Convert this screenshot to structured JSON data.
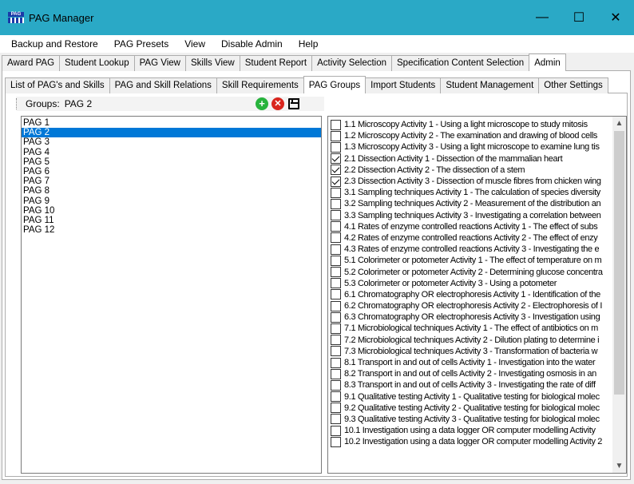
{
  "window": {
    "title": "PAG Manager",
    "icon_text": "PAG",
    "minimize": "—",
    "maximize": "☐",
    "close": "✕"
  },
  "menu": [
    {
      "label": "Backup and Restore"
    },
    {
      "label": "PAG Presets"
    },
    {
      "label": "View"
    },
    {
      "label": "Disable Admin"
    },
    {
      "label": "Help"
    }
  ],
  "main_tabs": [
    {
      "label": "Award PAG",
      "active": false
    },
    {
      "label": "Student Lookup",
      "active": false
    },
    {
      "label": "PAG View",
      "active": false
    },
    {
      "label": "Skills View",
      "active": false
    },
    {
      "label": "Student Report",
      "active": false
    },
    {
      "label": "Activity Selection",
      "active": false
    },
    {
      "label": "Specification Content Selection",
      "active": false
    },
    {
      "label": "Admin",
      "active": true
    }
  ],
  "admin_tabs": [
    {
      "label": "List of PAG's and Skills",
      "active": false
    },
    {
      "label": "PAG and Skill Relations",
      "active": false
    },
    {
      "label": "Skill Requirements",
      "active": false
    },
    {
      "label": "PAG Groups",
      "active": true
    },
    {
      "label": "Import Students",
      "active": false
    },
    {
      "label": "Student Management",
      "active": false
    },
    {
      "label": "Other Settings",
      "active": false
    }
  ],
  "toolbar": {
    "groups_label": "Groups:",
    "groups_value": "PAG 2",
    "add_icon": "add-icon",
    "delete_icon": "delete-icon",
    "save_icon": "save-icon"
  },
  "groups": [
    {
      "label": "PAG 1",
      "selected": false
    },
    {
      "label": "PAG 2",
      "selected": true
    },
    {
      "label": "PAG 3",
      "selected": false
    },
    {
      "label": "PAG 4",
      "selected": false
    },
    {
      "label": "PAG 5",
      "selected": false
    },
    {
      "label": "PAG 6",
      "selected": false
    },
    {
      "label": "PAG 7",
      "selected": false
    },
    {
      "label": "PAG 8",
      "selected": false
    },
    {
      "label": "PAG 9",
      "selected": false
    },
    {
      "label": "PAG 10",
      "selected": false
    },
    {
      "label": "PAG 11",
      "selected": false
    },
    {
      "label": "PAG 12",
      "selected": false
    }
  ],
  "activities": [
    {
      "label": "1.1 Microscopy Activity 1 - Using a light microscope to study mitosis",
      "checked": false
    },
    {
      "label": "1.2 Microscopy Activity 2 - The examination and drawing of blood cells",
      "checked": false
    },
    {
      "label": "1.3 Microscopy Activity 3 - Using a light microscope to examine lung tis",
      "checked": false
    },
    {
      "label": "2.1 Dissection Activity 1 - Dissection of the mammalian heart",
      "checked": true
    },
    {
      "label": "2.2 Dissection Activity 2 - The dissection of a stem",
      "checked": true
    },
    {
      "label": "2.3 Dissection Activity 3 - Dissection of muscle fibres from chicken wing",
      "checked": true
    },
    {
      "label": "3.1 Sampling techniques Activity 1 - The calculation of species diversity",
      "checked": false
    },
    {
      "label": "3.2 Sampling techniques Activity 2 - Measurement of the distribution an",
      "checked": false
    },
    {
      "label": "3.3 Sampling techniques Activity 3 - Investigating a correlation between",
      "checked": false
    },
    {
      "label": "4.1 Rates of enzyme controlled reactions Activity 1 - The effect of subs",
      "checked": false
    },
    {
      "label": "4.2 Rates of enzyme controlled reactions Activity 2 - The effect of enzy",
      "checked": false
    },
    {
      "label": "4.3 Rates of enzyme controlled reactions Activity 3 - Investigating the e",
      "checked": false
    },
    {
      "label": "5.1 Colorimeter or potometer Activity 1 - The effect of temperature on m",
      "checked": false
    },
    {
      "label": "5.2 Colorimeter or potometer Activity 2 - Determining glucose concentra",
      "checked": false
    },
    {
      "label": "5.3 Colorimeter or potometer Activity 3 - Using a potometer",
      "checked": false
    },
    {
      "label": "6.1 Chromatography OR electrophoresis Activity 1 - Identification of the",
      "checked": false
    },
    {
      "label": "6.2 Chromatography OR electrophoresis Activity 2 - Electrophoresis of I",
      "checked": false
    },
    {
      "label": "6.3 Chromatography OR electrophoresis Activity 3 - Investigation using",
      "checked": false
    },
    {
      "label": "7.1 Microbiological techniques Activity 1 - The effect of antibiotics on m",
      "checked": false
    },
    {
      "label": "7.2 Microbiological techniques Activity 2 - Dilution plating to determine i",
      "checked": false
    },
    {
      "label": "7.3 Microbiological techniques Activity 3 - Transformation of bacteria w",
      "checked": false
    },
    {
      "label": "8.1 Transport in and out of cells Activity 1 - Investigation into the water",
      "checked": false
    },
    {
      "label": "8.2 Transport in and out of cells Activity 2 - Investigating osmosis in an",
      "checked": false
    },
    {
      "label": "8.3 Transport in and out of cells Activity 3 - Investigating the rate of diff",
      "checked": false
    },
    {
      "label": "9.1 Qualitative testing Activity 1 - Qualitative testing for biological molec",
      "checked": false
    },
    {
      "label": "9.2 Qualitative testing Activity 2 - Qualitative testing for biological molec",
      "checked": false
    },
    {
      "label": "9.3 Qualitative testing Activity 3 - Qualitative testing for biological molec",
      "checked": false
    },
    {
      "label": "10.1 Investigation using a data logger OR computer modelling Activity",
      "checked": false
    },
    {
      "label": "10.2 Investigation using a data logger OR computer modelling Activity 2",
      "checked": false
    }
  ],
  "colors": {
    "titlebar": "#2aa9c6",
    "selection": "#0078d7",
    "add": "#27b33c",
    "delete": "#d9251d"
  }
}
